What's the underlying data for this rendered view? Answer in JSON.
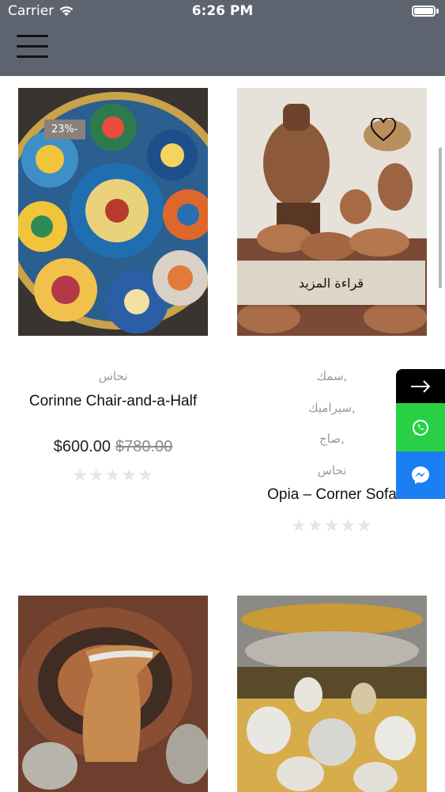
{
  "status_bar": {
    "carrier": "Carrier",
    "time": "6:26 PM"
  },
  "products": [
    {
      "badge": "23%-",
      "category": "نحاس",
      "title": "Corinne Chair-and-a-Half",
      "price": "$600.00",
      "old_price": "$780.00",
      "stars": "★★★★★"
    },
    {
      "categories": [
        "سمك,",
        "سيراميك,",
        "صاج,",
        "نحاس"
      ],
      "title": "Opia – Corner Sofa",
      "read_more": "قراءة المزيد",
      "stars": "★★★★★"
    }
  ],
  "side_buttons": [
    "arrow-right-icon",
    "whatsapp-icon",
    "messenger-icon"
  ],
  "colors": {
    "header": "#5e646f",
    "whatsapp": "#27d045",
    "messenger": "#1a7ff2",
    "badge": "#8a817c",
    "read_more_bg": "#ddd6c8"
  }
}
